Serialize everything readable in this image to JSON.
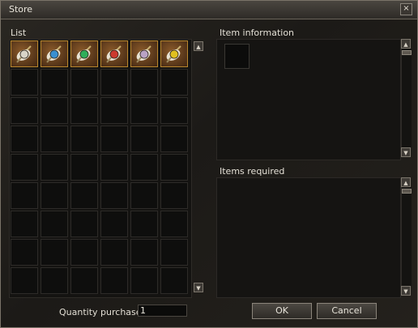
{
  "window": {
    "title": "Store",
    "close_symbol": "×"
  },
  "list": {
    "label": "List",
    "items": [
      {
        "name": "white-potion-icon",
        "color": "#d8d4c8"
      },
      {
        "name": "blue-potion-icon",
        "color": "#3a8fd0"
      },
      {
        "name": "green-potion-icon",
        "color": "#2fae5a"
      },
      {
        "name": "red-potion-icon",
        "color": "#cc3a2e"
      },
      {
        "name": "purple-potion-icon",
        "color": "#b9a2c4"
      },
      {
        "name": "yellow-potion-icon",
        "color": "#e0c020"
      }
    ],
    "scroll_up_symbol": "▲",
    "scroll_down_symbol": "▼"
  },
  "item_information": {
    "label": "Item information"
  },
  "items_required": {
    "label": "Items required"
  },
  "quantity": {
    "label": "Quantity purchased",
    "value": "1"
  },
  "buttons": {
    "ok": "OK",
    "cancel": "Cancel"
  }
}
